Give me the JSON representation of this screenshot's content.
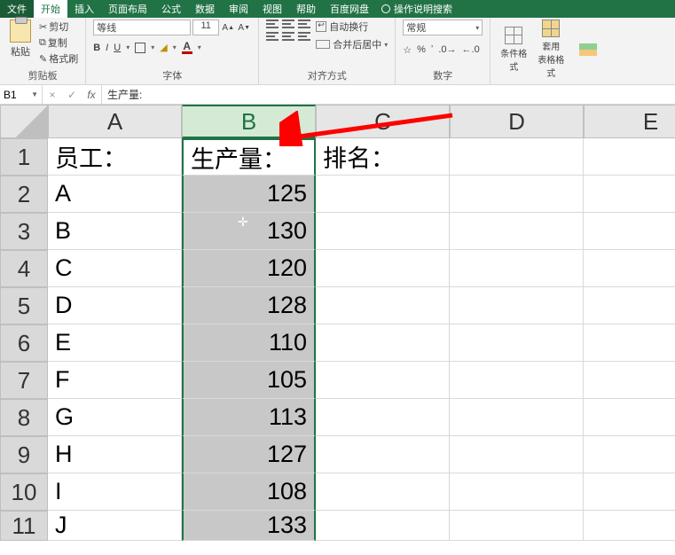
{
  "menu": {
    "file": "文件",
    "home": "开始",
    "insert": "插入",
    "layout": "页面布局",
    "formula": "公式",
    "data": "数据",
    "review": "审阅",
    "view": "视图",
    "help": "帮助",
    "netdisk": "百度网盘",
    "tell": "操作说明搜索"
  },
  "ribbon": {
    "clipboard": {
      "name": "剪贴板",
      "paste": "粘贴",
      "cut": "剪切",
      "copy": "复制",
      "fmt": "格式刷"
    },
    "font": {
      "name": "字体",
      "family": "等线",
      "size": "11",
      "A_up": "A",
      "A_dn": "A"
    },
    "align": {
      "name": "对齐方式",
      "wrap": "自动换行",
      "merge": "合并后居中"
    },
    "number": {
      "name": "数字",
      "general": "常规"
    },
    "styles": {
      "cond": "条件格式",
      "table": "套用\n表格格式"
    }
  },
  "fx": {
    "cell_ref": "B1",
    "value": "生产量:"
  },
  "grid": {
    "cols": [
      "A",
      "B",
      "C",
      "D",
      "E"
    ],
    "headers": {
      "a": "员工：",
      "b": "生产量：",
      "c": "排名："
    },
    "rows": [
      {
        "n": "1"
      },
      {
        "n": "2",
        "emp": "A",
        "prod": "125"
      },
      {
        "n": "3",
        "emp": "B",
        "prod": "130"
      },
      {
        "n": "4",
        "emp": "C",
        "prod": "120"
      },
      {
        "n": "5",
        "emp": "D",
        "prod": "128"
      },
      {
        "n": "6",
        "emp": "E",
        "prod": "110"
      },
      {
        "n": "7",
        "emp": "F",
        "prod": "105"
      },
      {
        "n": "8",
        "emp": "G",
        "prod": "113"
      },
      {
        "n": "9",
        "emp": "H",
        "prod": "127"
      },
      {
        "n": "10",
        "emp": "I",
        "prod": "108"
      },
      {
        "n": "11",
        "emp": "J",
        "prod": "133"
      }
    ]
  },
  "chart_data": {
    "type": "table",
    "columns": [
      "员工",
      "生产量",
      "排名"
    ],
    "data": [
      [
        "A",
        125,
        null
      ],
      [
        "B",
        130,
        null
      ],
      [
        "C",
        120,
        null
      ],
      [
        "D",
        128,
        null
      ],
      [
        "E",
        110,
        null
      ],
      [
        "F",
        105,
        null
      ],
      [
        "G",
        113,
        null
      ],
      [
        "H",
        127,
        null
      ],
      [
        "I",
        108,
        null
      ],
      [
        "J",
        133,
        null
      ]
    ]
  }
}
